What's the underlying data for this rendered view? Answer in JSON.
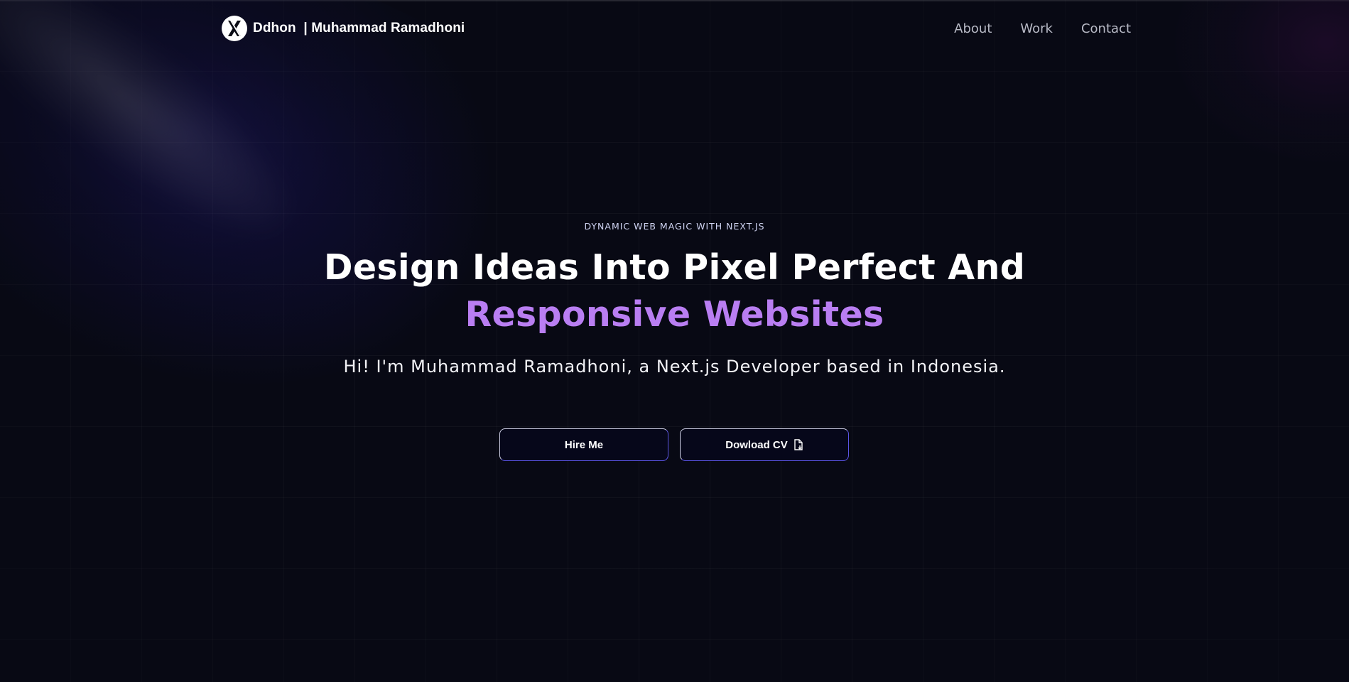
{
  "header": {
    "brand_name": "Ddhon  | Muhammad Ramadhoni",
    "logo_icon": "x-logo-icon",
    "nav": [
      {
        "label": "About"
      },
      {
        "label": "Work"
      },
      {
        "label": "Contact"
      }
    ]
  },
  "hero": {
    "eyebrow": "DYNAMIC WEB MAGIC WITH NEXT.JS",
    "headline_line1": "Design Ideas Into Pixel Perfect And",
    "headline_line2": "Responsive Websites",
    "intro": "Hi! I'm Muhammad Ramadhoni, a Next.js Developer based in Indonesia.",
    "buttons": {
      "hire_label": "Hire Me",
      "cv_label": "Dowload CV",
      "cv_icon": "file-download-icon"
    }
  },
  "colors": {
    "background": "#080914",
    "accent_purple": "#b97ef2",
    "button_border": "#5b55e6"
  }
}
